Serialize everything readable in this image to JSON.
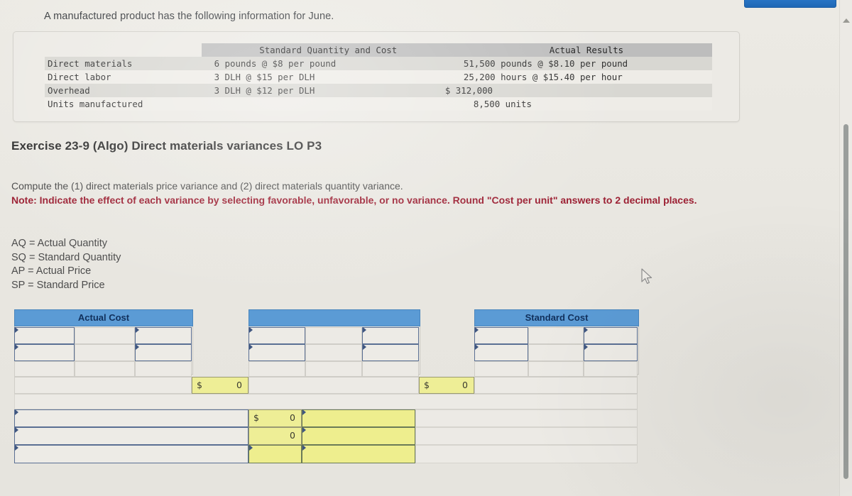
{
  "prompt": {
    "text": "A manufactured product has the following information for June."
  },
  "info_table": {
    "headers": [
      "",
      "Standard Quantity and Cost",
      "Actual Results"
    ],
    "rows": [
      {
        "label": "Direct materials",
        "standard": "6 pounds @ $8 per pound",
        "actual": "51,500 pounds @ $8.10 per pound"
      },
      {
        "label": "Direct labor",
        "standard": "3 DLH @ $15 per DLH",
        "actual": "25,200 hours @ $15.40 per hour"
      },
      {
        "label": "Overhead",
        "standard": "3 DLH @ $12 per DLH",
        "actual": "$ 312,000"
      },
      {
        "label": "Units manufactured",
        "standard": "",
        "actual": "8,500 units"
      }
    ]
  },
  "exercise": {
    "title": "Exercise 23-9 (Algo) Direct materials variances LO P3",
    "instruction": "Compute the (1) direct materials price variance and (2) direct materials quantity variance.",
    "note": "Note: Indicate the effect of each variance by selecting favorable, unfavorable, or no variance. Round \"Cost per unit\" answers to 2 decimal places."
  },
  "legend": {
    "lines": [
      "AQ = Actual Quantity",
      "SQ = Standard Quantity",
      "AP = Actual Price",
      "SP = Standard Price"
    ]
  },
  "worksheet": {
    "headers": {
      "actual_cost": "Actual Cost",
      "middle": "",
      "standard_cost": "Standard Cost"
    },
    "inputs": {
      "placeholder": ""
    },
    "totals": {
      "actual_total_symbol": "$",
      "actual_total_value": "0",
      "standard_total_symbol": "$",
      "standard_total_value": "0"
    },
    "variance_rows": [
      {
        "label": "",
        "symbol": "$",
        "value": "0",
        "effect": ""
      },
      {
        "label": "",
        "symbol": "",
        "value": "0",
        "effect": ""
      },
      {
        "label": "",
        "symbol": "",
        "value": "",
        "effect": ""
      }
    ]
  },
  "colors": {
    "header_blue": "#5b9bd5",
    "header_text": "#11305c",
    "highlight_yellow": "#eeee96",
    "note_red": "#9c2033",
    "page_bg": "#eceae5",
    "input_border": "#5a6f93"
  }
}
